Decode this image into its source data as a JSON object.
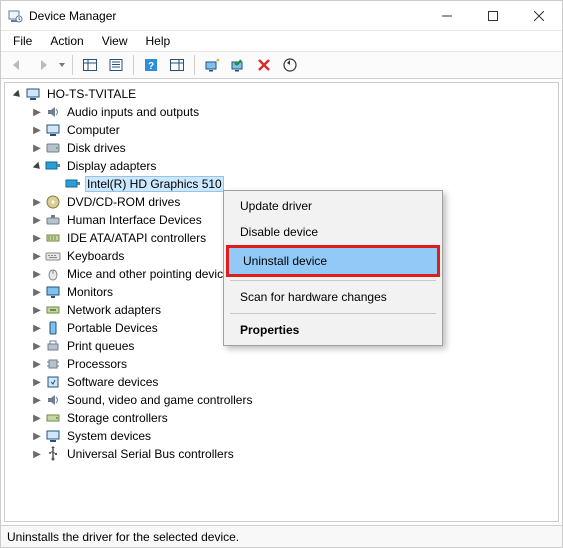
{
  "window": {
    "title": "Device Manager"
  },
  "menubar": {
    "file": "File",
    "action": "Action",
    "view": "View",
    "help": "Help"
  },
  "tree": {
    "root": "HO-TS-TVITALE",
    "categories": {
      "audio": "Audio inputs and outputs",
      "computer": "Computer",
      "disk": "Disk drives",
      "display": "Display adapters",
      "display_child": "Intel(R) HD Graphics 510",
      "dvd": "DVD/CD-ROM drives",
      "hid": "Human Interface Devices",
      "ide": "IDE ATA/ATAPI controllers",
      "keyboards": "Keyboards",
      "mice": "Mice and other pointing devices",
      "monitors": "Monitors",
      "network": "Network adapters",
      "portable": "Portable Devices",
      "printqueues": "Print queues",
      "processors": "Processors",
      "softdev": "Software devices",
      "sound": "Sound, video and game controllers",
      "storage": "Storage controllers",
      "system": "System devices",
      "usb": "Universal Serial Bus controllers"
    }
  },
  "context_menu": {
    "update": "Update driver",
    "disable": "Disable device",
    "uninstall": "Uninstall device",
    "scan": "Scan for hardware changes",
    "properties": "Properties"
  },
  "statusbar": {
    "text": "Uninstalls the driver for the selected device."
  }
}
